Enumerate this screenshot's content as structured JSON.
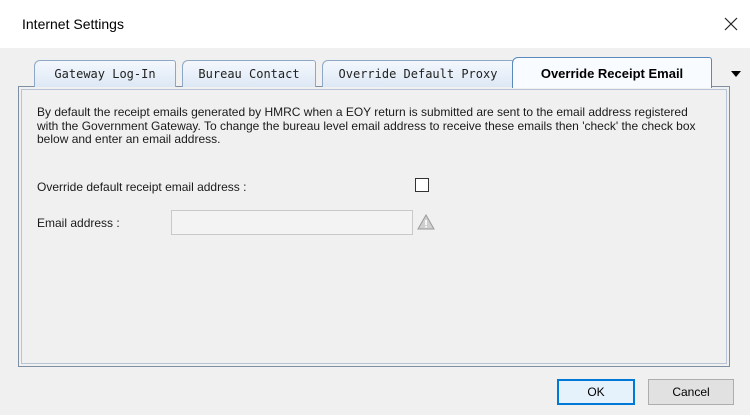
{
  "window": {
    "title": "Internet Settings",
    "close_icon": "close-icon"
  },
  "tabs": [
    {
      "label": "Gateway Log-In",
      "active": false
    },
    {
      "label": "Bureau Contact",
      "active": false
    },
    {
      "label": "Override Default Proxy",
      "active": false
    },
    {
      "label": "Override Receipt Email",
      "active": true
    }
  ],
  "tab_scroll_icon": "dropdown-arrow-icon",
  "panel": {
    "description": "By default the receipt emails generated by HMRC when a EOY return is submitted are sent to the email address registered with the Government Gateway. To change the bureau level email address to receive these emails then 'check' the check box below and enter an email address.",
    "override_label": "Override default receipt email address :",
    "override_checked": false,
    "email_label": "Email address :",
    "email_value": "",
    "email_placeholder": "",
    "warning_icon": "warning-icon"
  },
  "buttons": {
    "ok_label": "OK",
    "cancel_label": "Cancel"
  },
  "colors": {
    "accent": "#0078d7",
    "tab_border": "#8ea7c4",
    "dialog_bg": "#f0f0f0"
  }
}
